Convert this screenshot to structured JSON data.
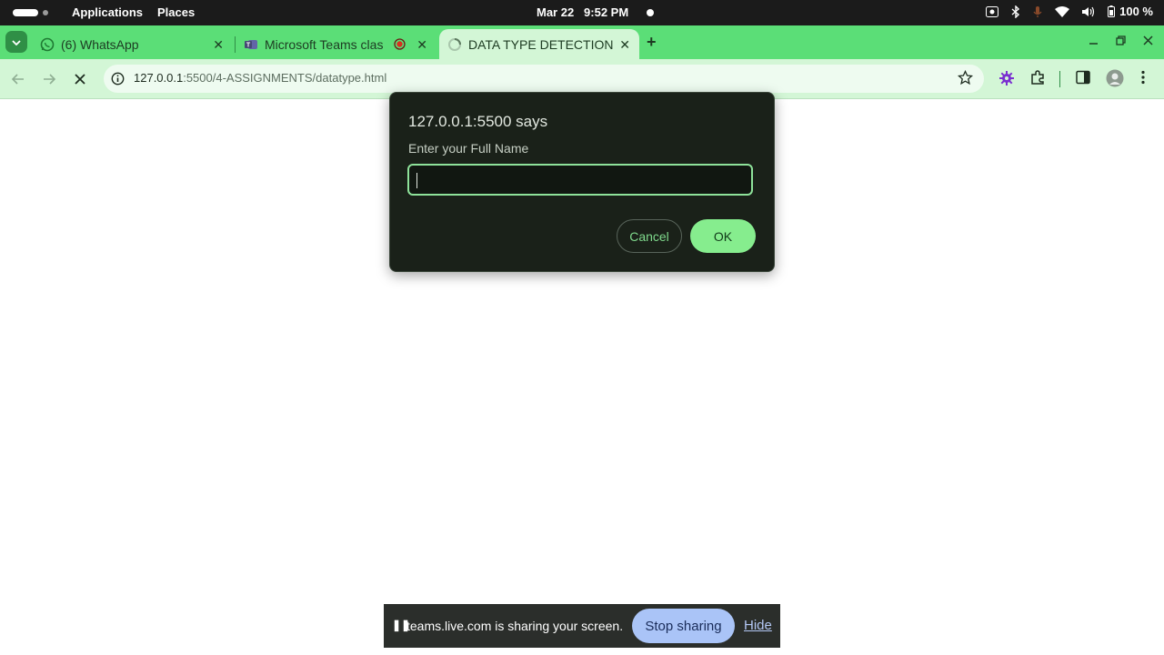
{
  "topbar": {
    "applications": "Applications",
    "places": "Places",
    "date": "Mar 22",
    "time": "9:52 PM",
    "battery": "100 %",
    "icons": [
      "screencast-icon",
      "bluetooth-icon",
      "mic-off-icon",
      "wifi-icon",
      "volume-icon",
      "battery-icon"
    ]
  },
  "tabs": [
    {
      "title": "(6) WhatsApp",
      "icon": "whatsapp-icon"
    },
    {
      "title": "Microsoft Teams clas",
      "icon": "teams-icon",
      "recording": true
    },
    {
      "title": "DATA TYPE DETECTION",
      "icon": "loading-icon",
      "active": true
    }
  ],
  "browser": {
    "url_host": "127.0.0.1",
    "url_rest": ":5500/4-ASSIGNMENTS/datatype.html"
  },
  "dialog": {
    "title": "127.0.0.1:5500 says",
    "message": "Enter your Full Name",
    "input_value": "",
    "cancel_label": "Cancel",
    "ok_label": "OK"
  },
  "sharebar": {
    "message": "teams.live.com is sharing your screen.",
    "stop_label": "Stop sharing",
    "hide_label": "Hide"
  },
  "colors": {
    "tabstrip": "#5bde77",
    "toolbar": "#d3f6d6",
    "dialog_bg": "#1a2119",
    "ok_button": "#86ed8e",
    "stop_button": "#aac4f7"
  }
}
